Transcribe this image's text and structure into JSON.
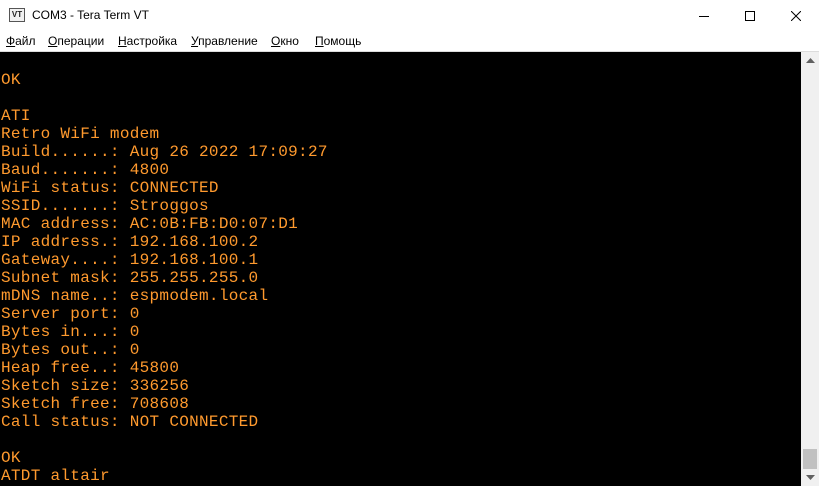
{
  "window": {
    "icon_label": "VT",
    "title": "COM3 - Tera Term VT"
  },
  "menu": [
    {
      "underline": "Ф",
      "rest": "айл"
    },
    {
      "underline": "О",
      "rest": "перации"
    },
    {
      "underline": "Н",
      "rest": "астройка"
    },
    {
      "underline": "У",
      "rest": "правление"
    },
    {
      "underline": "О",
      "rest": "кно"
    },
    {
      "underline": "П",
      "rest": "омощь"
    }
  ],
  "terminal": {
    "text_color": "#ff9a2e",
    "background": "#000000",
    "lines": [
      "OK",
      "",
      "ATI",
      "Retro WiFi modem",
      "Build......: Aug 26 2022 17:09:27",
      "Baud.......: 4800",
      "WiFi status: CONNECTED",
      "SSID.......: Stroggos",
      "MAC address: AC:0B:FB:D0:07:D1",
      "IP address.: 192.168.100.2",
      "Gateway....: 192.168.100.1",
      "Subnet mask: 255.255.255.0",
      "mDNS name..: espmodem.local",
      "Server port: 0",
      "Bytes in...: 0",
      "Bytes out..: 0",
      "Heap free..: 45800",
      "Sketch size: 336256",
      "Sketch free: 708608",
      "Call status: NOT CONNECTED",
      "",
      "OK",
      "ATDT altair"
    ]
  }
}
